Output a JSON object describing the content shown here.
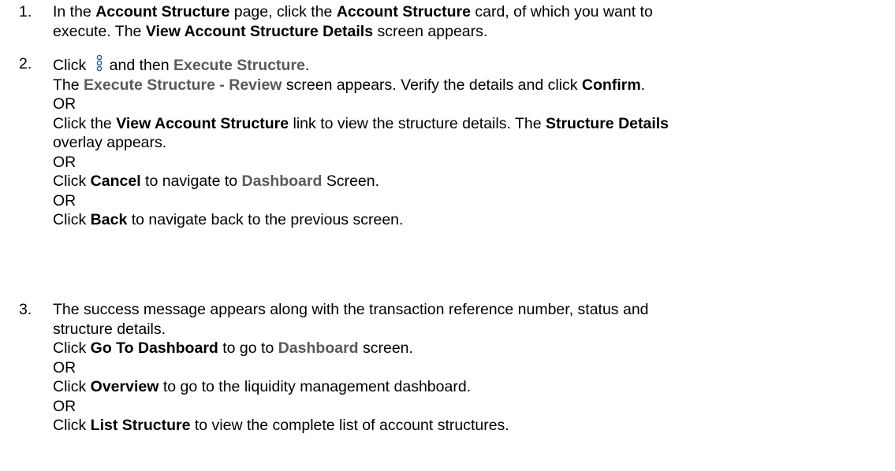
{
  "steps": [
    {
      "number": "1.",
      "lines": [
        [
          {
            "t": " In the "
          },
          {
            "t": "Account Structure",
            "b": 1
          },
          {
            "t": " page, click the "
          },
          {
            "t": "Account Structure",
            "b": 1
          },
          {
            "t": " card, of which you want to"
          }
        ],
        [
          {
            "t": "execute. The "
          },
          {
            "t": "View Account Structure Details",
            "b": 1
          },
          {
            "t": " screen appears."
          }
        ]
      ]
    },
    {
      "number": "2.",
      "lines": [
        [
          {
            "t": "Click "
          },
          {
            "icon": "kebab-menu-icon"
          },
          {
            "t": "and then "
          },
          {
            "t": "Execute Structure",
            "b": 1,
            "g": 1
          },
          {
            "t": "."
          }
        ],
        [
          {
            "t": "The "
          },
          {
            "t": "Execute Structure - Review",
            "b": 1,
            "g": 1
          },
          {
            "t": " screen appears. Verify the details and click "
          },
          {
            "t": "Confirm",
            "b": 1
          },
          {
            "t": "."
          }
        ],
        [
          {
            "t": "OR"
          }
        ],
        [
          {
            "t": "Click the "
          },
          {
            "t": "View Account Structure",
            "b": 1
          },
          {
            "t": " link to view the structure details. The "
          },
          {
            "t": "Structure Details",
            "b": 1
          }
        ],
        [
          {
            "t": "overlay appears."
          }
        ],
        [
          {
            "t": "OR"
          }
        ],
        [
          {
            "t": "Click "
          },
          {
            "t": "Cancel",
            "b": 1
          },
          {
            "t": " to navigate to "
          },
          {
            "t": "Dashboard",
            "b": 1,
            "g": 1
          },
          {
            "t": " Screen."
          }
        ],
        [
          {
            "t": "OR"
          }
        ],
        [
          {
            "t": "Click "
          },
          {
            "t": "Back",
            "b": 1
          },
          {
            "t": " to navigate back to the previous screen."
          }
        ]
      ]
    },
    {
      "number": "3.",
      "lines": [
        [
          {
            "t": "The success message appears along with the transaction reference number, status and"
          }
        ],
        [
          {
            "t": "structure details."
          }
        ],
        [
          {
            "t": "Click "
          },
          {
            "t": "Go To Dashboard",
            "b": 1
          },
          {
            "t": " to go to "
          },
          {
            "t": "Dashboard",
            "b": 1,
            "g": 1
          },
          {
            "t": " screen."
          }
        ],
        [
          {
            "t": "OR"
          }
        ],
        [
          {
            "t": "Click "
          },
          {
            "t": "Overview",
            "b": 1
          },
          {
            "t": " to go to the liquidity management dashboard."
          }
        ],
        [
          {
            "t": "OR"
          }
        ],
        [
          {
            "t": "Click "
          },
          {
            "t": "List Structure",
            "b": 1
          },
          {
            "t": " to view the complete list of account structures."
          }
        ]
      ]
    }
  ]
}
